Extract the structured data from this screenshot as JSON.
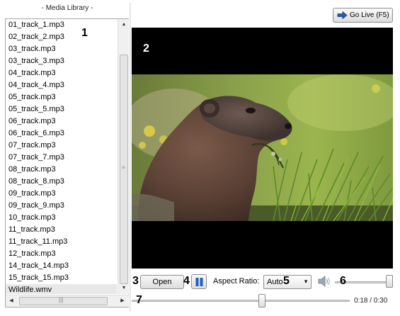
{
  "library": {
    "title": "- Media Library -",
    "items": [
      "01_track_1.mp3",
      "02_track_2.mp3",
      "03_track.mp3",
      "03_track_3.mp3",
      "04_track.mp3",
      "04_track_4.mp3",
      "05_track.mp3",
      "05_track_5.mp3",
      "06_track.mp3",
      "06_track_6.mp3",
      "07_track.mp3",
      "07_track_7.mp3",
      "08_track.mp3",
      "08_track_8.mp3",
      "09_track.mp3",
      "09_track_9.mp3",
      "10_track.mp3",
      "11_track.mp3",
      "11_track_11.mp3",
      "12_track.mp3",
      "14_track_14.mp3",
      "15_track_15.mp3",
      "Wildlife.wmv"
    ],
    "selected_index": 22
  },
  "toolbar": {
    "go_live_label": "Go Live (F5)"
  },
  "controls": {
    "open_label": "Open",
    "aspect_label": "Aspect Ratio:",
    "aspect_value": "Auto",
    "volume_fraction": 1.0,
    "time_display": "0:18 / 0:30",
    "position_seconds": 18,
    "duration_seconds": 30
  },
  "annotations": {
    "n1": "1",
    "n2": "2",
    "n3": "3",
    "n4": "4",
    "n5": "5",
    "n6": "6",
    "n7": "7"
  },
  "colors": {
    "video_background": "#000000",
    "pause_icon": "#1f5fbf",
    "go_live_arrow": "#2a5ca8"
  }
}
